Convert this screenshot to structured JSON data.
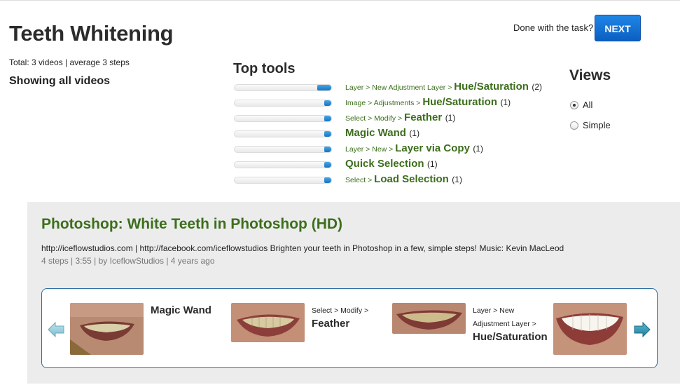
{
  "header": {
    "title": "Teeth Whitening",
    "summary": "Total: 3 videos | average 3 steps",
    "showing": "Showing all videos",
    "done_text": "Done with the task?",
    "next_label": "NEXT"
  },
  "top_tools": {
    "title": "Top tools",
    "items": [
      {
        "path": "Layer > New Adjustment Layer > ",
        "name": "Hue/Saturation",
        "count": "(2)",
        "level": 1.0
      },
      {
        "path": "Image > Adjustments > ",
        "name": "Hue/Saturation",
        "count": "(1)",
        "level": 0.5
      },
      {
        "path": "Select > Modify > ",
        "name": "Feather",
        "count": "(1)",
        "level": 0.5
      },
      {
        "path": "",
        "name": "Magic Wand",
        "count": "(1)",
        "level": 0.5
      },
      {
        "path": "Layer > New > ",
        "name": "Layer via Copy",
        "count": "(1)",
        "level": 0.5
      },
      {
        "path": "",
        "name": "Quick Selection",
        "count": "(1)",
        "level": 0.5
      },
      {
        "path": "Select > ",
        "name": "Load Selection",
        "count": "(1)",
        "level": 0.5
      }
    ]
  },
  "views": {
    "title": "Views",
    "options": [
      {
        "label": "All",
        "selected": true
      },
      {
        "label": "Simple",
        "selected": false
      }
    ]
  },
  "video": {
    "title": "Photoshop: White Teeth in Photoshop (HD)",
    "description": "http://iceflowstudios.com | http://facebook.com/iceflowstudios Brighten your teeth in Photoshop in a few, simple steps! Music: Kevin MacLeod",
    "meta": "4 steps | 3:55 | by IceflowStudios | 4 years ago",
    "steps": [
      {
        "path1": "",
        "path2": "",
        "name": "Magic Wand"
      },
      {
        "path1": "Select > Modify >",
        "path2": "",
        "name": "Feather"
      },
      {
        "path1": "Layer > New",
        "path2": "Adjustment Layer >",
        "name": "Hue/Saturation"
      }
    ]
  },
  "colors": {
    "accent_green": "#3c6e1c",
    "button_blue": "#1373d6",
    "carousel_border": "#2a6ea6"
  }
}
